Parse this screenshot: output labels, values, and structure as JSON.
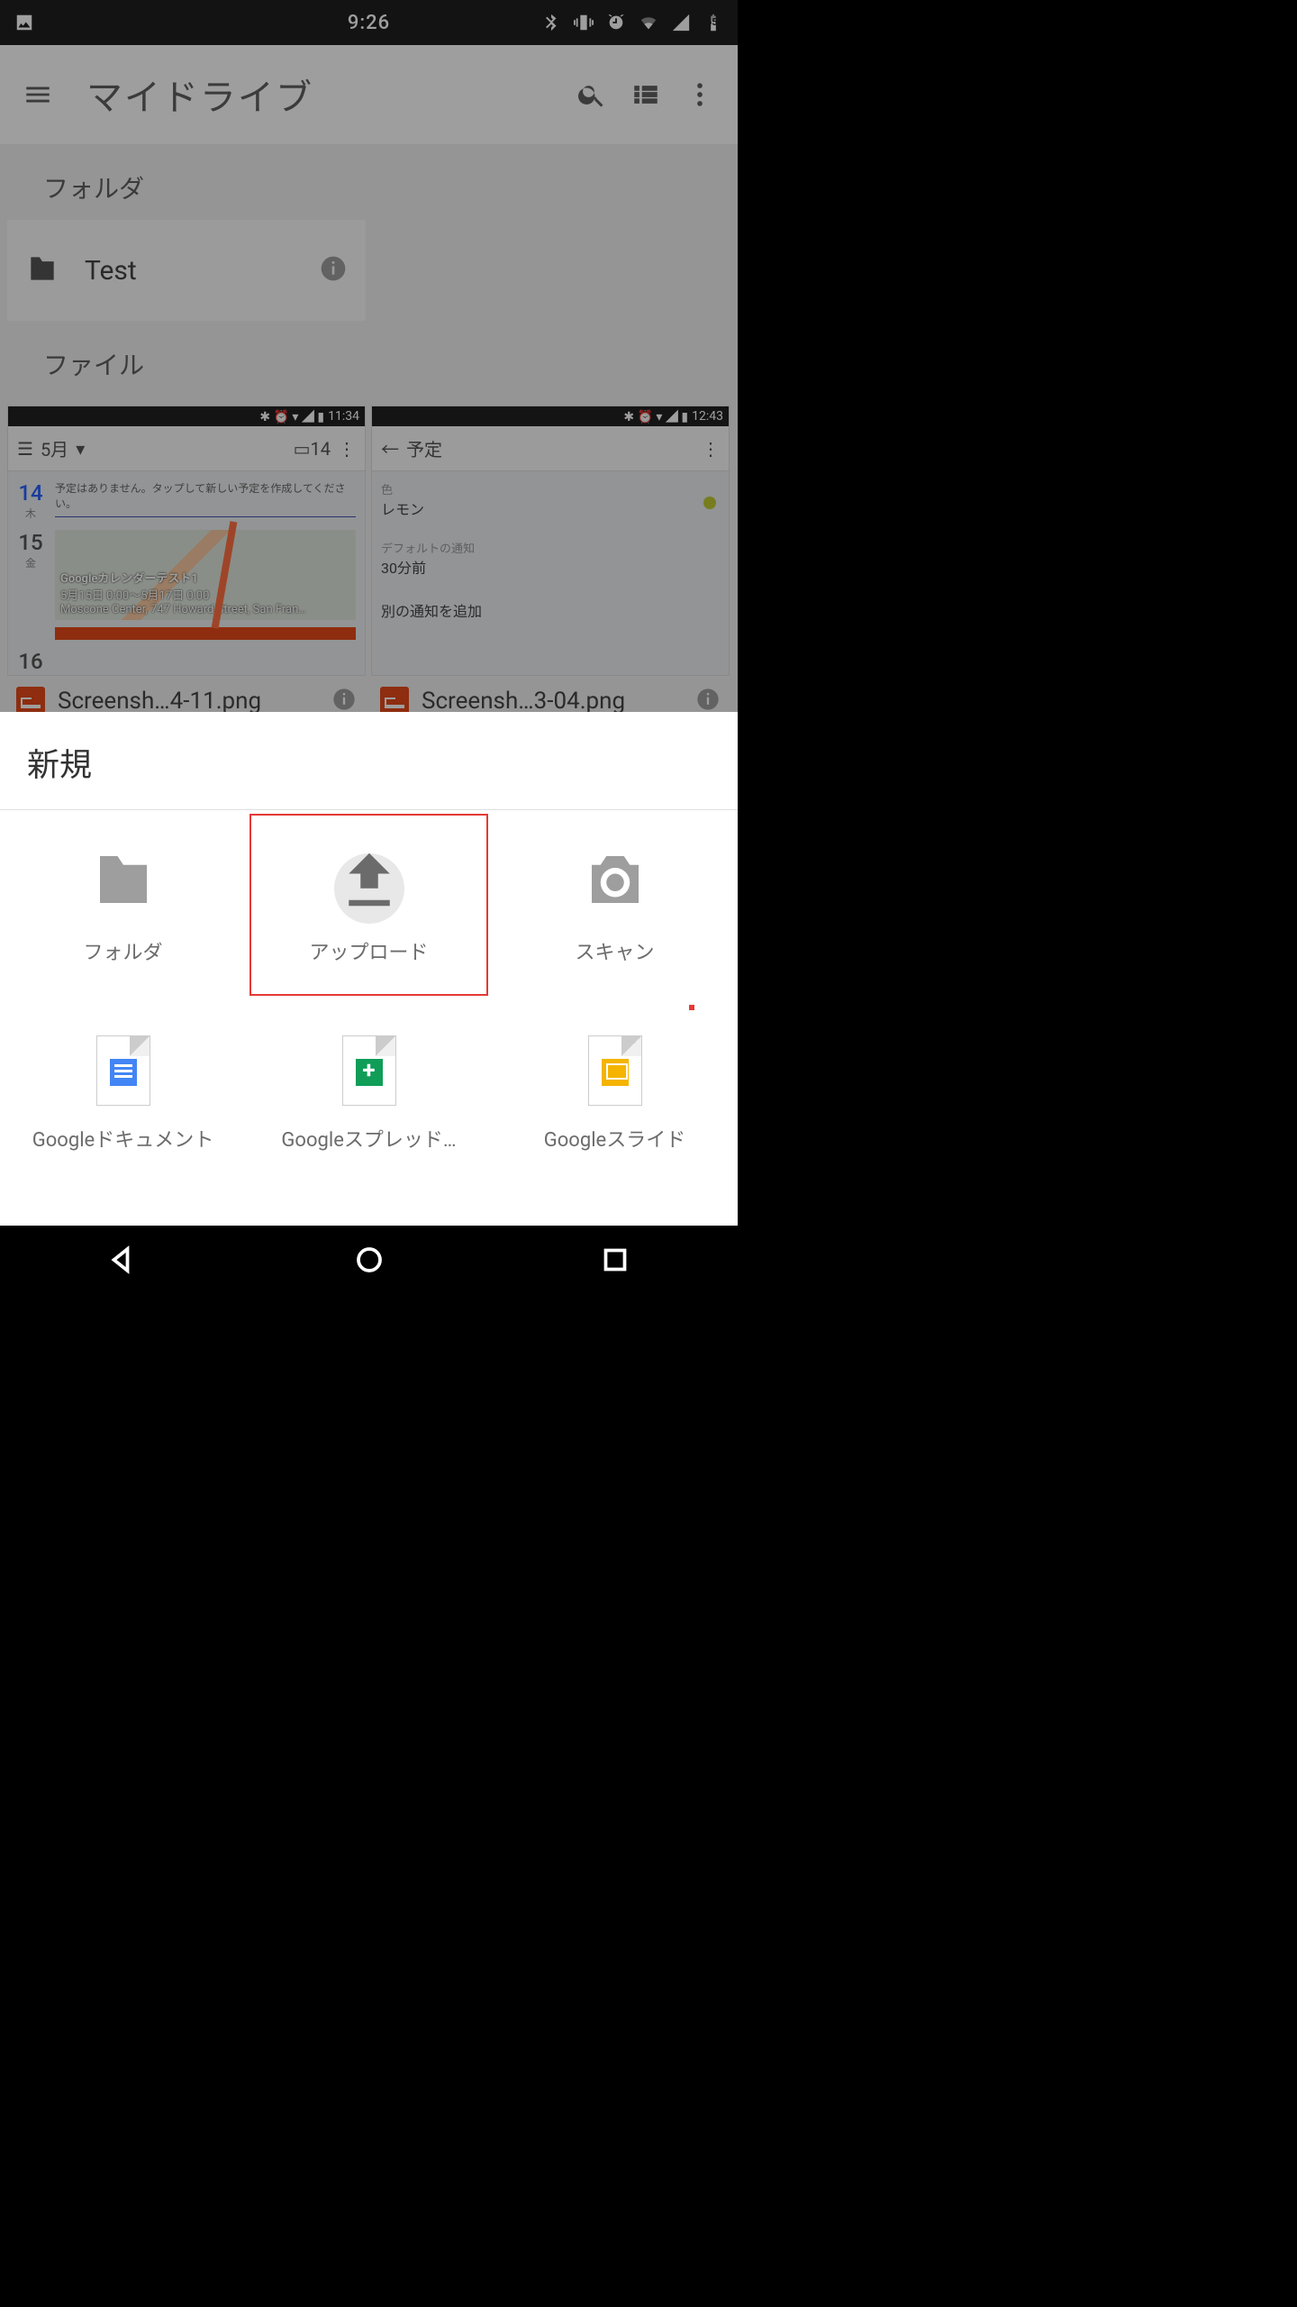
{
  "status_bar": {
    "time": "9:26",
    "battery": "65"
  },
  "app_bar": {
    "title": "マイドライブ"
  },
  "sections": {
    "folders_label": "フォルダ",
    "files_label": "ファイル"
  },
  "folders": [
    {
      "name": "Test"
    }
  ],
  "files": [
    {
      "name": "Screensh…4-11.png",
      "thumb": {
        "time": "11:34",
        "toolbar_label": "5月",
        "date1_num": "14",
        "date1_dow": "木",
        "date1_text": "予定はありません。タップして新しい予定を作成してください。",
        "date2_num": "15",
        "date2_dow": "金",
        "event_title": "Googleカレンダーテスト1",
        "event_time": "5月15日 0:00〜5月17日 0:00",
        "event_loc": "Moscone Center, 747 Howard Street, San Fran…",
        "date3_num": "16"
      }
    },
    {
      "name": "Screensh…3-04.png",
      "thumb": {
        "time": "12:43",
        "toolbar_label": "予定",
        "color_label": "色",
        "color_value": "レモン",
        "notify_label": "デフォルトの通知",
        "notify_value": "30分前",
        "add_notify": "別の通知を追加"
      }
    }
  ],
  "sheet": {
    "title": "新規",
    "items": {
      "folder": "フォルダ",
      "upload": "アップロード",
      "scan": "スキャン",
      "docs": "Googleドキュメント",
      "sheets": "Googleスプレッド…",
      "slides": "Googleスライド"
    }
  }
}
